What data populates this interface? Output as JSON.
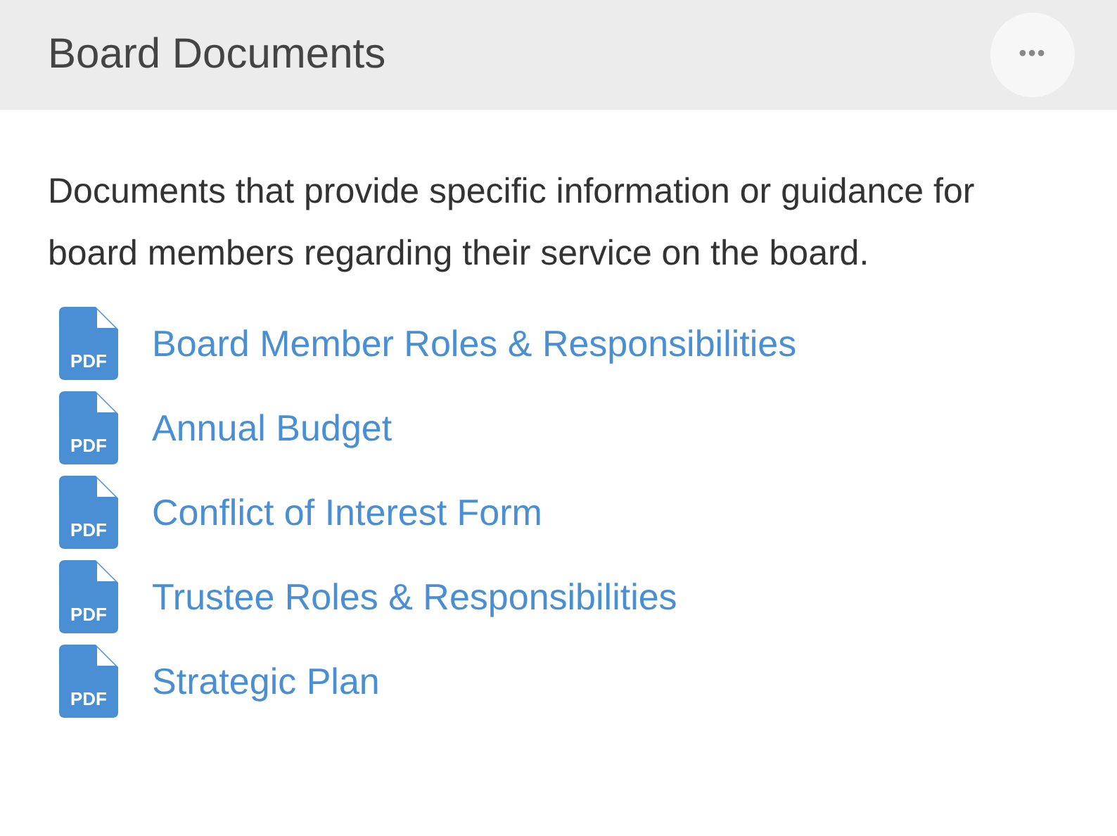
{
  "panel": {
    "title": "Board Documents",
    "menu_button": "•••"
  },
  "description": "Documents that provide specific information or guidance for board members regarding their service on the board.",
  "documents": [
    {
      "file_type": "PDF",
      "title": "Board Member Roles & Responsibilities"
    },
    {
      "file_type": "PDF",
      "title": "Annual Budget"
    },
    {
      "file_type": "PDF",
      "title": "Conflict of Interest Form"
    },
    {
      "file_type": "PDF",
      "title": "Trustee Roles & Responsibilities"
    },
    {
      "file_type": "PDF",
      "title": "Strategic Plan"
    }
  ]
}
